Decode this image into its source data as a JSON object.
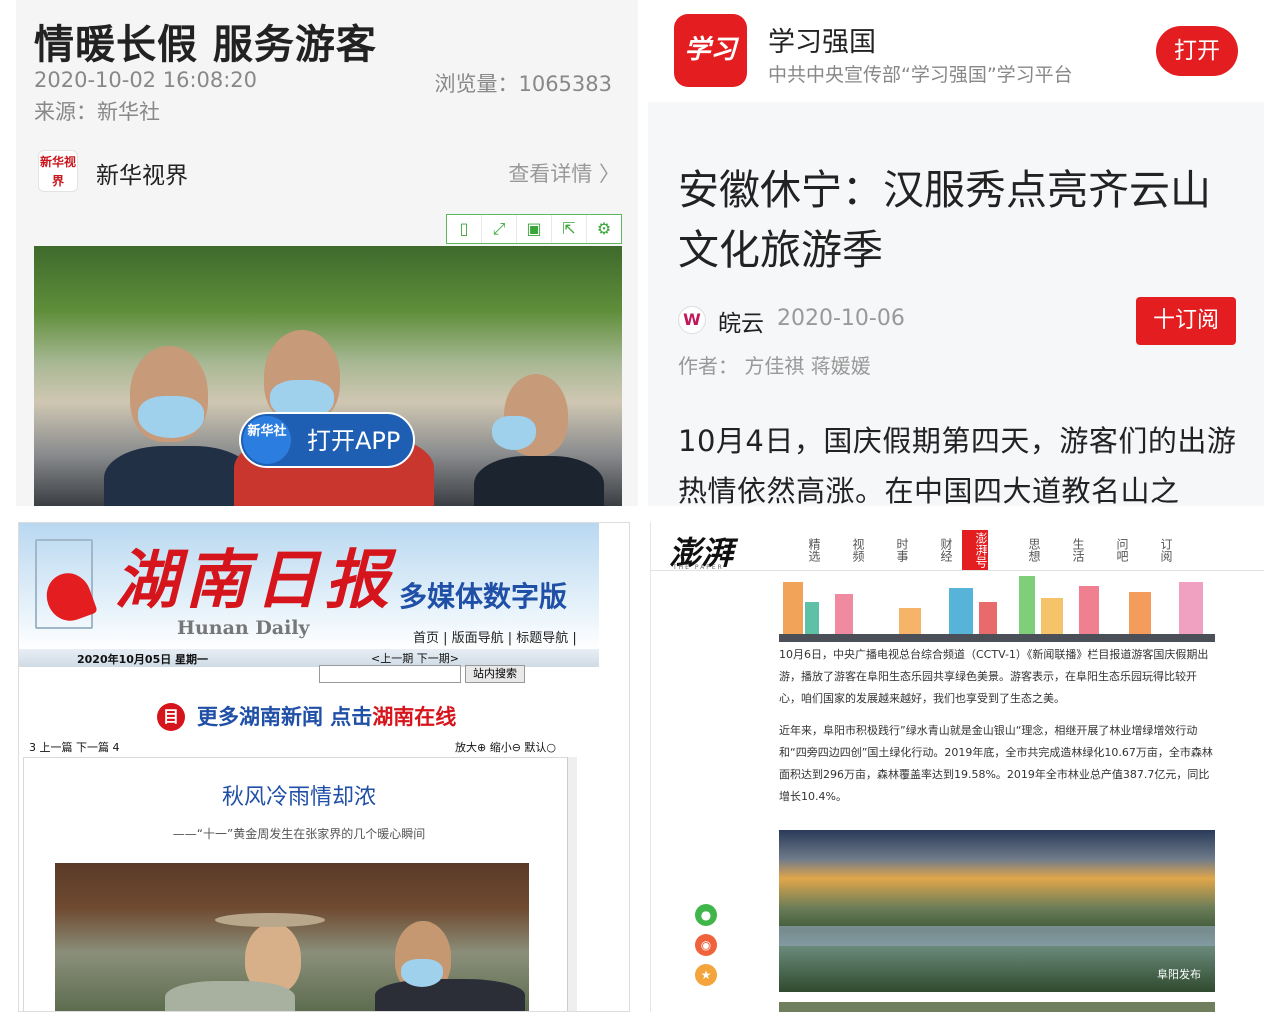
{
  "panel1": {
    "headline": "情暖长假 服务游客",
    "datetime": "2020-10-02 16:08:20",
    "views_label": "浏览量：",
    "views": "1065383",
    "source": "来源：新华社",
    "logo_text": "新华视界",
    "source_name": "新华视界",
    "detail_link": "查看详情 〉",
    "toolbar_icons": [
      "bookmark-icon",
      "fullscreen-icon",
      "save-icon",
      "share-icon",
      "settings-icon"
    ],
    "app_badge": "新华社",
    "open_app": "打开APP"
  },
  "panel2": {
    "app_logo": "学习",
    "app_name": "学习强国",
    "app_desc": "中共中央宣传部“学习强国”学习平台",
    "open": "打开",
    "title": "安徽休宁：汉服秀点亮齐云山文化旅游季",
    "source_icon": "W",
    "source": "皖云",
    "date": "2020-10-06",
    "subscribe": "十订阅",
    "author": "作者： 方佳祺 蒋媛媛",
    "body": "10月4日，国庆假期第四天，游客们的出游热情依然高涨。在中国四大道教名山之"
  },
  "panel3": {
    "title": "湖南日报",
    "title_en": "Hunan Daily",
    "digital": "多媒体数字版",
    "nav": "首页 | 版面导航 | 标题导航 |",
    "date": "2020年10月05日 星期一",
    "issue": "<上一期    下一期>",
    "search_btn": "站内搜索",
    "promo_icon": "目",
    "promo_a": "更多湖南新闻 点击",
    "promo_b": "湖南在线",
    "pager": "3 上一篇    下一篇 4",
    "zoom": "放大⊕ 缩小⊖ 默认○",
    "article_title": "秋风冷雨情却浓",
    "article_sub": "——“十一”黄金周发生在张家界的几个暖心瞬间"
  },
  "panel4": {
    "logo": "澎湃",
    "logo_sub": "THE PAPER",
    "tabs": [
      "精选",
      "视频",
      "时事",
      "财经",
      "澎湃号",
      "思想",
      "生活",
      "问吧",
      "订阅"
    ],
    "para1": "10月6日，中央广播电视总台综合频道（CCTV-1）《新闻联播》栏目报道游客国庆假期出游，播放了游客在阜阳生态乐园共享绿色美景。游客表示，在阜阳生态乐园玩得比较开心，咱们国家的发展越来越好，我们也享受到了生态之美。",
    "para2": "近年来，阜阳市积极践行”绿水青山就是金山银山“理念，相继开展了林业增绿增效行动和“四旁四边四创”国土绿化行动。2019年底，全市共完成造林绿化10.67万亩，全市森林面积达到296万亩，森林覆盖率达到19.58%。2019年全市林业总产值387.7亿元，同比增长10.4%。",
    "watermark": "阜阳发布",
    "share_icons": [
      "wechat-icon",
      "weibo-icon",
      "favorite-icon"
    ]
  }
}
